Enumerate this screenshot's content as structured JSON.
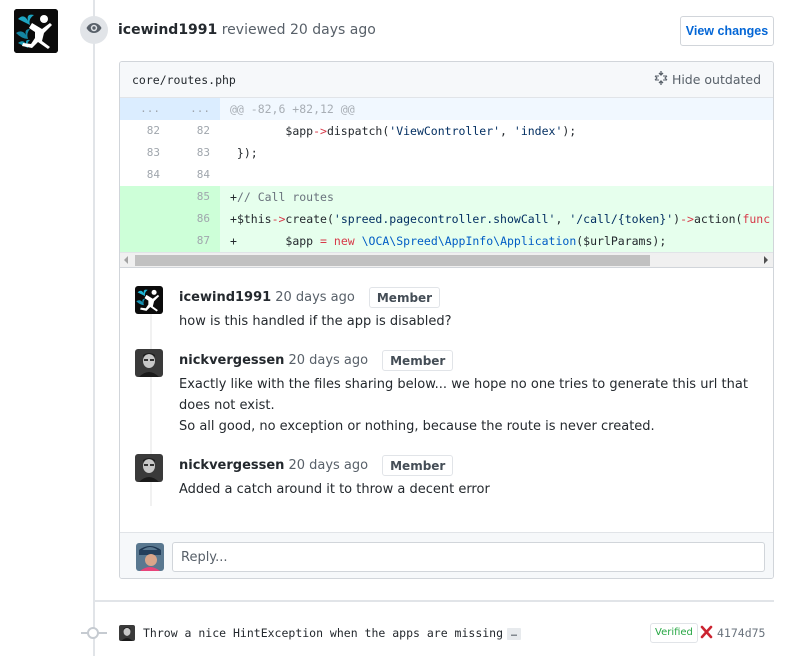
{
  "review": {
    "author": "icewind1991",
    "action_text": "reviewed 20 days ago",
    "view_changes_label": "View changes"
  },
  "file": {
    "path": "core/routes.php",
    "hide_outdated_label": "Hide outdated"
  },
  "diff": {
    "hunk": {
      "old": "...",
      "new": "...",
      "text": "@@ -82,6 +82,12 @@"
    },
    "context_lines": [
      {
        "old": "82",
        "new": "82"
      },
      {
        "old": "83",
        "new": "83",
        "text": " });"
      },
      {
        "old": "84",
        "new": "84",
        "text": ""
      }
    ],
    "line82": {
      "indent": "        ",
      "var": "$app",
      "arrow": "->",
      "call": "dispatch(",
      "str1": "'ViewController'",
      "sep": ", ",
      "str2": "'index'",
      "end": ");"
    },
    "added_lines": [
      {
        "new": "85",
        "plus": "+",
        "comment": "// Call routes"
      },
      {
        "new": "86",
        "plus": "+",
        "var": "$this",
        "arrow": "->",
        "call": "create(",
        "str1": "'spreed.pagecontroller.showCall'",
        "sep": ", ",
        "str2": "'/call/{token}'",
        "close": ")",
        "arrow2": "->",
        "call2": "action(",
        "tail": "func"
      },
      {
        "new": "87",
        "plus": "+",
        "indent": "       ",
        "var": "$app",
        "assign": " = ",
        "kw": "new",
        "space": " ",
        "cls": "\\OCA\\Spreed\\AppInfo\\Application",
        "end": "($urlParams);"
      }
    ]
  },
  "comments": [
    {
      "author": "icewind1991",
      "time": "20 days ago",
      "badge": "Member",
      "lines": [
        "how is this handled if the app is disabled?"
      ]
    },
    {
      "author": "nickvergessen",
      "time": "20 days ago",
      "badge": "Member",
      "lines": [
        "Exactly like with the files sharing below... we hope no one tries to generate this url that does not exist.",
        "So all good, no exception or nothing, because the route is never created."
      ]
    },
    {
      "author": "nickvergessen",
      "time": "20 days ago",
      "badge": "Member",
      "lines": [
        "Added a catch around it to throw a decent error"
      ]
    }
  ],
  "reply": {
    "placeholder": "Reply..."
  },
  "commit": {
    "message": "Throw a nice HintException when the apps are missing",
    "ellipsis": "…",
    "verified_label": "Verified",
    "status_icon": "x-icon",
    "sha": "4174d75"
  },
  "colors": {
    "link": "#0366d6",
    "verified": "#28a745",
    "failure": "#cb2431",
    "addition_bg": "#e6ffed",
    "hunk_bg": "#f1f8ff"
  }
}
